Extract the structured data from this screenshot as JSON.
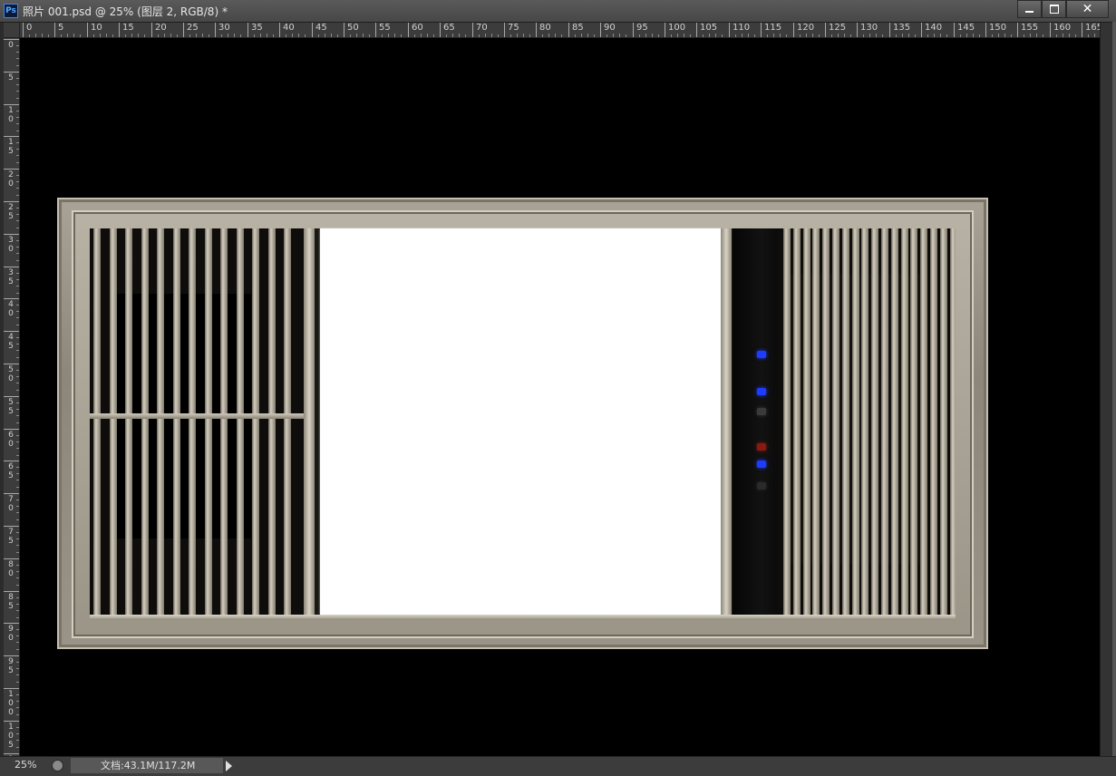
{
  "window": {
    "app_icon": "Ps",
    "title": "照片 001.psd @ 25% (图层 2, RGB/8) *",
    "buttons": {
      "minimize": "minimize-icon",
      "maximize": "maximize-icon",
      "close": "close-icon"
    }
  },
  "ruler": {
    "horizontal_labels": [
      "0",
      "5",
      "10",
      "15",
      "20",
      "25",
      "30",
      "35",
      "40",
      "45",
      "50",
      "55",
      "60",
      "65",
      "70",
      "75",
      "80",
      "85",
      "90",
      "95",
      "100",
      "105",
      "110",
      "115",
      "120",
      "125",
      "130",
      "135",
      "140",
      "145",
      "150",
      "155",
      "160",
      "165"
    ],
    "vertical_labels": [
      "0",
      "5",
      "10",
      "15",
      "20",
      "25",
      "30",
      "35",
      "40",
      "45",
      "50",
      "55",
      "60",
      "65",
      "70",
      "75",
      "80",
      "85",
      "90",
      "95",
      "100",
      "105",
      "1"
    ]
  },
  "canvas": {
    "background": "#000000",
    "content": "bathroom-heater-panel-image"
  },
  "status": {
    "zoom": "25%",
    "doc_info": "文档:43.1M/117.2M"
  },
  "colors": {
    "control_indicator_blue": "#1e3cff",
    "control_indicator_red": "#8a1a10"
  }
}
